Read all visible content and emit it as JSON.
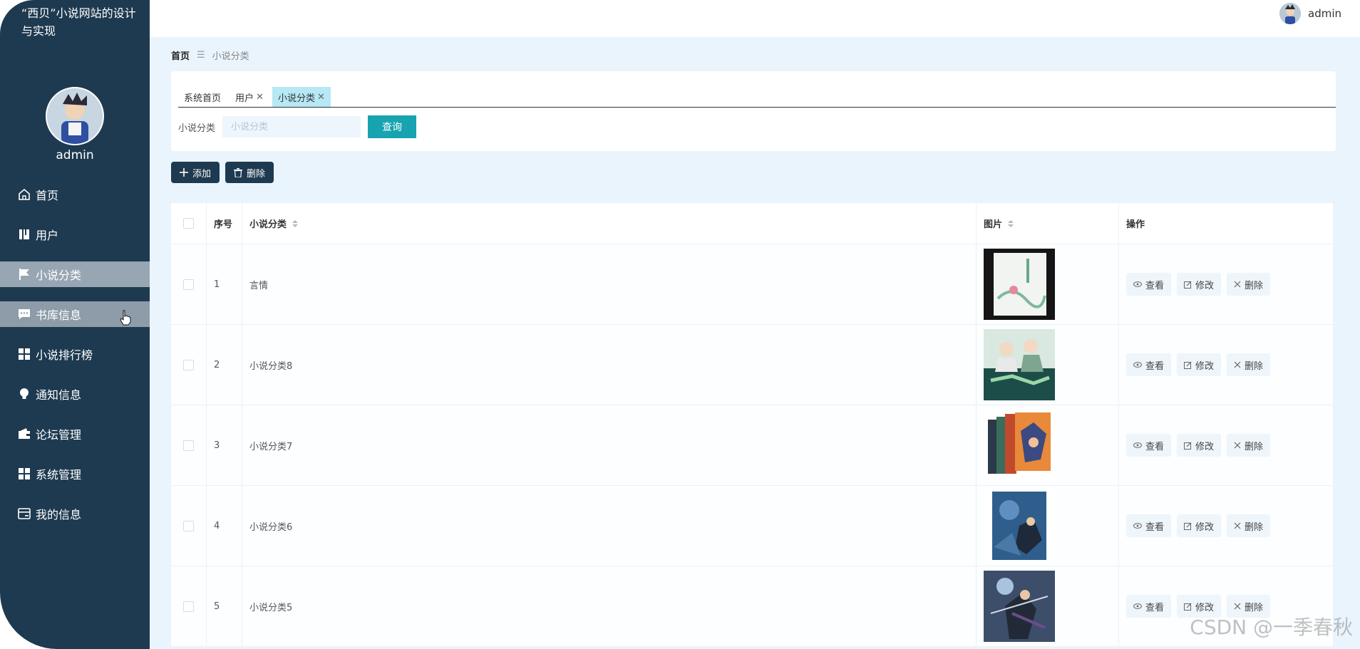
{
  "sidebar": {
    "site_title": "“西贝”小说网站的设计与实现",
    "username": "admin",
    "items": [
      {
        "label": "首页",
        "icon": "home-icon"
      },
      {
        "label": "用户",
        "icon": "book-icon"
      },
      {
        "label": "小说分类",
        "icon": "flag-icon"
      },
      {
        "label": "书库信息",
        "icon": "chat-icon"
      },
      {
        "label": "小说排行榜",
        "icon": "grid-icon"
      },
      {
        "label": "通知信息",
        "icon": "bulb-icon"
      },
      {
        "label": "论坛管理",
        "icon": "wallet-icon"
      },
      {
        "label": "系统管理",
        "icon": "grid-icon"
      },
      {
        "label": "我的信息",
        "icon": "card-icon"
      }
    ]
  },
  "topbar": {
    "username": "admin"
  },
  "breadcrumb": {
    "home": "首页",
    "current": "小说分类"
  },
  "tabs": [
    {
      "label": "系统首页"
    },
    {
      "label": "用户"
    },
    {
      "label": "小说分类"
    }
  ],
  "search": {
    "label": "小说分类",
    "placeholder": "小说分类",
    "button": "查询"
  },
  "toolbar": {
    "add": "添加",
    "delete": "删除"
  },
  "table": {
    "headers": {
      "index": "序号",
      "name": "小说分类",
      "image": "图片",
      "ops": "操作"
    },
    "rows": [
      {
        "index": "1",
        "name": "言情"
      },
      {
        "index": "2",
        "name": "小说分类8"
      },
      {
        "index": "3",
        "name": "小说分类7"
      },
      {
        "index": "4",
        "name": "小说分类6"
      },
      {
        "index": "5",
        "name": "小说分类5"
      }
    ],
    "op_labels": {
      "view": "查看",
      "edit": "修改",
      "delete": "删除"
    }
  },
  "watermark": "CSDN @一季春秋",
  "colors": {
    "sidebar": "#1d3a50",
    "accent": "#17a3b0",
    "background": "#eaf4fd"
  }
}
